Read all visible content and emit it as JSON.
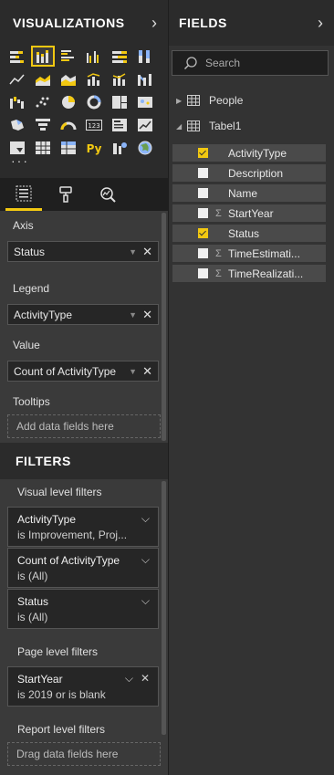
{
  "viz_pane": {
    "title": "VISUALIZATIONS",
    "ellipsis": "···",
    "icons": [
      "stacked-bar-icon",
      "stacked-column-icon",
      "clustered-bar-icon",
      "clustered-column-icon",
      "100-stacked-bar-icon",
      "100-stacked-column-icon",
      "line-chart-icon",
      "area-chart-icon",
      "stacked-area-icon",
      "line-column-icon",
      "line-stacked-column-icon",
      "ribbon-chart-icon",
      "waterfall-icon",
      "scatter-icon",
      "pie-icon",
      "donut-icon",
      "treemap-icon",
      "map-icon",
      "filled-map-icon",
      "funnel-icon",
      "gauge-icon",
      "card-icon",
      "multi-row-card-icon",
      "kpi-icon",
      "slicer-icon",
      "table-icon",
      "matrix-icon",
      "python-visual-icon",
      "r-visual-icon",
      "globe-icon"
    ],
    "python_glyph": "Py",
    "card_glyph": "123",
    "tabs": [
      "fields-tab-icon",
      "format-tab-icon",
      "analytics-tab-icon"
    ]
  },
  "wells": {
    "axis_label": "Axis",
    "axis_value": "Status",
    "legend_label": "Legend",
    "legend_value": "ActivityType",
    "value_label": "Value",
    "value_value": "Count of ActivityType",
    "tooltips_label": "Tooltips",
    "tooltips_placeholder": "Add data fields here"
  },
  "filters": {
    "title": "FILTERS",
    "visual_level_label": "Visual level filters",
    "visual_filters": [
      {
        "name": "ActivityType",
        "value": "is Improvement, Proj..."
      },
      {
        "name": "Count of ActivityType",
        "value": "is (All)"
      },
      {
        "name": "Status",
        "value": "is (All)"
      }
    ],
    "page_level_label": "Page level filters",
    "page_filters": [
      {
        "name": "StartYear",
        "value": "is 2019 or is blank"
      }
    ],
    "report_level_label": "Report level filters",
    "report_placeholder": "Drag data fields here"
  },
  "fields_pane": {
    "title": "FIELDS",
    "search_placeholder": "Search",
    "tables": [
      {
        "name": "People",
        "expanded": false
      },
      {
        "name": "Tabel1",
        "expanded": true
      }
    ],
    "fields": [
      {
        "name": "ActivityType",
        "checked": true,
        "sigma": false
      },
      {
        "name": "Description",
        "checked": false,
        "sigma": false
      },
      {
        "name": "Name",
        "checked": false,
        "sigma": false
      },
      {
        "name": "StartYear",
        "checked": false,
        "sigma": true
      },
      {
        "name": "Status",
        "checked": true,
        "sigma": false
      },
      {
        "name": "TimeEstimati...",
        "checked": false,
        "sigma": true
      },
      {
        "name": "TimeRealizati...",
        "checked": false,
        "sigma": true
      }
    ],
    "sigma_glyph": "Σ"
  },
  "colors": {
    "accent": "#f2c811",
    "pane_bg": "#333333",
    "chip_bg": "#262626"
  }
}
